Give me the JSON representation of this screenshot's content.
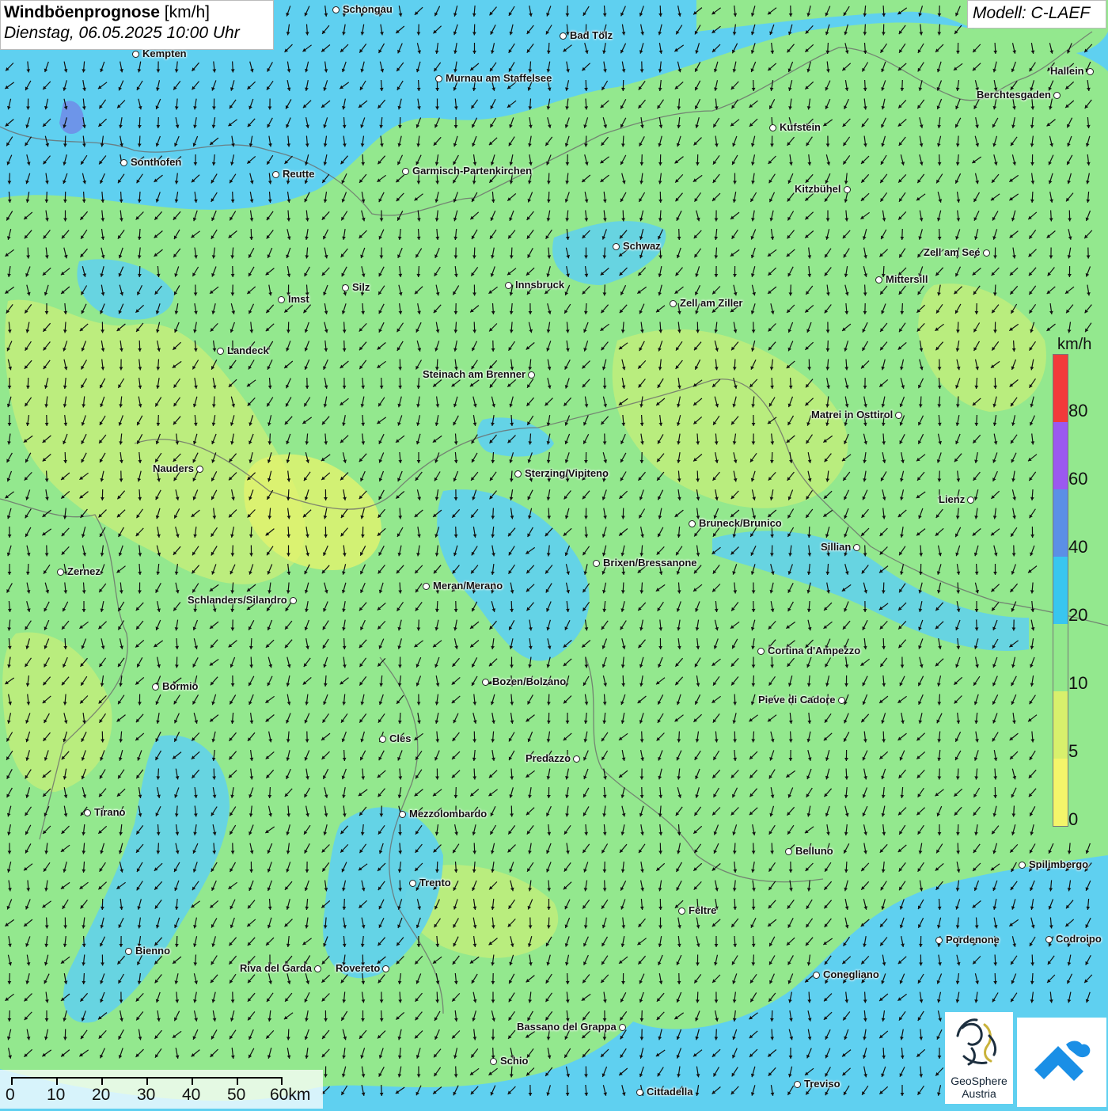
{
  "header": {
    "title_bold": "Windböenprognose",
    "title_unit": " [km/h]",
    "datetime": "Dienstag, 06.05.2025 10:00 Uhr",
    "model": "Modell: C-LAEF"
  },
  "legend": {
    "unit": "km/h",
    "labels": [
      "80",
      "60",
      "40",
      "20",
      "10",
      "5",
      "0"
    ],
    "colors": [
      "#f23a3a",
      "#9b59ef",
      "#5b8fe6",
      "#38c6ef",
      "#92e88c",
      "#d8f06c",
      "#f4f56a"
    ]
  },
  "scalebar": {
    "labels": [
      "0",
      "10",
      "20",
      "30",
      "40",
      "50",
      "60km"
    ]
  },
  "logo": {
    "line1": "GeoSphere",
    "line2": "Austria"
  },
  "cities": [
    {
      "name": "Schongau"
    },
    {
      "name": "Bad Tölz"
    },
    {
      "name": "Kempten"
    },
    {
      "name": "Murnau am Staffelsee"
    },
    {
      "name": "Hallein"
    },
    {
      "name": "Berchtesgaden"
    },
    {
      "name": "Kufstein"
    },
    {
      "name": "Sonthofen"
    },
    {
      "name": "Reutte"
    },
    {
      "name": "Garmisch-Partenkirchen"
    },
    {
      "name": "Kitzbühel"
    },
    {
      "name": "Schwaz"
    },
    {
      "name": "Zell am See"
    },
    {
      "name": "Innsbruck"
    },
    {
      "name": "Mittersill"
    },
    {
      "name": "Silz"
    },
    {
      "name": "Imst"
    },
    {
      "name": "Zell am Ziller"
    },
    {
      "name": "Landeck"
    },
    {
      "name": "Steinach am Brenner"
    },
    {
      "name": "Matrei in Osttirol"
    },
    {
      "name": "Nauders"
    },
    {
      "name": "Sterzing/Vipiteno"
    },
    {
      "name": "Lienz"
    },
    {
      "name": "Bruneck/Brunico"
    },
    {
      "name": "Sillian"
    },
    {
      "name": "Brixen/Bressanone"
    },
    {
      "name": "Zernez"
    },
    {
      "name": "Meran/Merano"
    },
    {
      "name": "Schlanders/Silandro"
    },
    {
      "name": "Cortina d'Ampezzo"
    },
    {
      "name": "Bozen/Bolzano"
    },
    {
      "name": "Bormio"
    },
    {
      "name": "Pieve di Cadore"
    },
    {
      "name": "Cles"
    },
    {
      "name": "Predazzo"
    },
    {
      "name": "Tirano"
    },
    {
      "name": "Mezzolombardo"
    },
    {
      "name": "Belluno"
    },
    {
      "name": "Spilimbergo"
    },
    {
      "name": "Trento"
    },
    {
      "name": "Feltre"
    },
    {
      "name": "Pordenone"
    },
    {
      "name": "Codroipo"
    },
    {
      "name": "Bienno"
    },
    {
      "name": "Riva del Garda"
    },
    {
      "name": "Rovereto"
    },
    {
      "name": "Conegliano"
    },
    {
      "name": "Bassano del Grappa"
    },
    {
      "name": "Schio"
    },
    {
      "name": "Treviso"
    },
    {
      "name": "Cittadella"
    }
  ]
}
